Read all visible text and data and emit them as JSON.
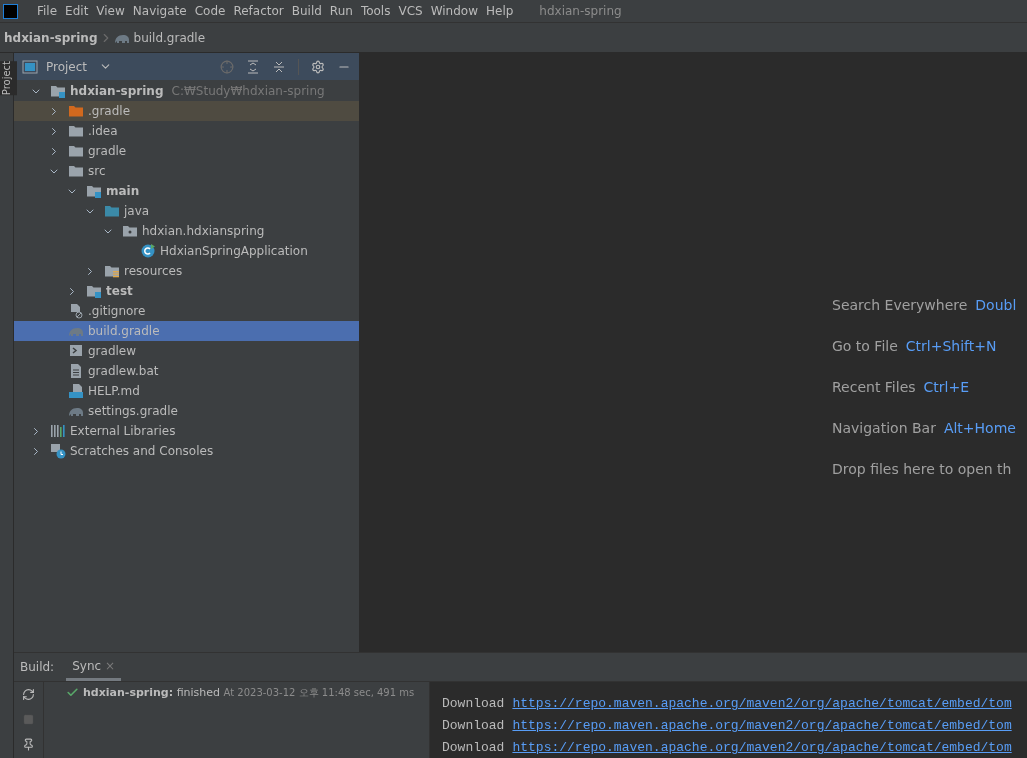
{
  "menu": {
    "items": [
      "File",
      "Edit",
      "View",
      "Navigate",
      "Code",
      "Refactor",
      "Build",
      "Run",
      "Tools",
      "VCS",
      "Window",
      "Help"
    ],
    "title": "hdxian-spring"
  },
  "breadcrumb": [
    "hdxian-spring",
    "build.gradle"
  ],
  "side_stripe": {
    "tab": "Project"
  },
  "project_panel": {
    "title": "Project",
    "tree": [
      {
        "label": "hdxian-spring",
        "hint": "C:₩Study₩hdxian-spring",
        "kind": "module",
        "bold": true,
        "expanded": true,
        "selected": false,
        "highlighted": false,
        "children": [
          {
            "label": ".gradle",
            "kind": "excluded",
            "bold": false,
            "expanded": false,
            "selected": false,
            "highlighted": true
          },
          {
            "label": ".idea",
            "kind": "folder",
            "bold": false,
            "expanded": false,
            "selected": false,
            "highlighted": false
          },
          {
            "label": "gradle",
            "kind": "folder",
            "bold": false,
            "expanded": false,
            "selected": false,
            "highlighted": false
          },
          {
            "label": "src",
            "kind": "folder",
            "bold": false,
            "expanded": true,
            "selected": false,
            "highlighted": false,
            "children": [
              {
                "label": "main",
                "kind": "module",
                "bold": true,
                "expanded": true,
                "selected": false,
                "highlighted": false,
                "children": [
                  {
                    "label": "java",
                    "kind": "source",
                    "bold": false,
                    "expanded": true,
                    "selected": false,
                    "highlighted": false,
                    "children": [
                      {
                        "label": "hdxian.hdxianspring",
                        "kind": "package",
                        "bold": false,
                        "expanded": true,
                        "selected": false,
                        "highlighted": false,
                        "children": [
                          {
                            "label": "HdxianSpringApplication",
                            "kind": "class",
                            "bold": false,
                            "selected": false,
                            "highlighted": false
                          }
                        ]
                      }
                    ]
                  },
                  {
                    "label": "resources",
                    "kind": "resources",
                    "bold": false,
                    "expanded": false,
                    "selected": false,
                    "highlighted": false
                  }
                ]
              },
              {
                "label": "test",
                "kind": "module",
                "bold": true,
                "expanded": false,
                "selected": false,
                "highlighted": false
              }
            ]
          },
          {
            "label": ".gitignore",
            "kind": "ignore",
            "bold": false,
            "selected": false,
            "highlighted": false
          },
          {
            "label": "build.gradle",
            "kind": "gradle",
            "bold": false,
            "selected": true,
            "highlighted": false
          },
          {
            "label": "gradlew",
            "kind": "script",
            "bold": false,
            "selected": false,
            "highlighted": false
          },
          {
            "label": "gradlew.bat",
            "kind": "text",
            "bold": false,
            "selected": false,
            "highlighted": false
          },
          {
            "label": "HELP.md",
            "kind": "markdown",
            "bold": false,
            "selected": false,
            "highlighted": false
          },
          {
            "label": "settings.gradle",
            "kind": "gradle",
            "bold": false,
            "selected": false,
            "highlighted": false
          }
        ]
      },
      {
        "label": "External Libraries",
        "kind": "libraries",
        "bold": false,
        "expanded": false,
        "selected": false,
        "highlighted": false
      },
      {
        "label": "Scratches and Consoles",
        "kind": "scratches",
        "bold": false,
        "expanded": false,
        "selected": false,
        "highlighted": false
      }
    ]
  },
  "welcome": [
    {
      "action": "Search Everywhere",
      "shortcut": "Doubl"
    },
    {
      "action": "Go to File",
      "shortcut": "Ctrl+Shift+N"
    },
    {
      "action": "Recent Files",
      "shortcut": "Ctrl+E"
    },
    {
      "action": "Navigation Bar",
      "shortcut": "Alt+Home"
    },
    {
      "action": "Drop files here to open th"
    }
  ],
  "build_panel": {
    "label": "Build:",
    "tabs": [
      {
        "label": "Sync",
        "selected": true,
        "close": "×"
      }
    ],
    "result": {
      "name": "hdxian-spring:",
      "status": "finished",
      "time": "At 2023-03-12 오후 11:48 sec, 491 ms"
    },
    "console": [
      {
        "word": "Download",
        "url": "https://repo.maven.apache.org/maven2/org/apache/tomcat/embed/tom"
      },
      {
        "word": "Download",
        "url": "https://repo.maven.apache.org/maven2/org/apache/tomcat/embed/tom"
      },
      {
        "word": "Download",
        "url": "https://repo.maven.apache.org/maven2/org/apache/tomcat/embed/tom"
      }
    ]
  }
}
